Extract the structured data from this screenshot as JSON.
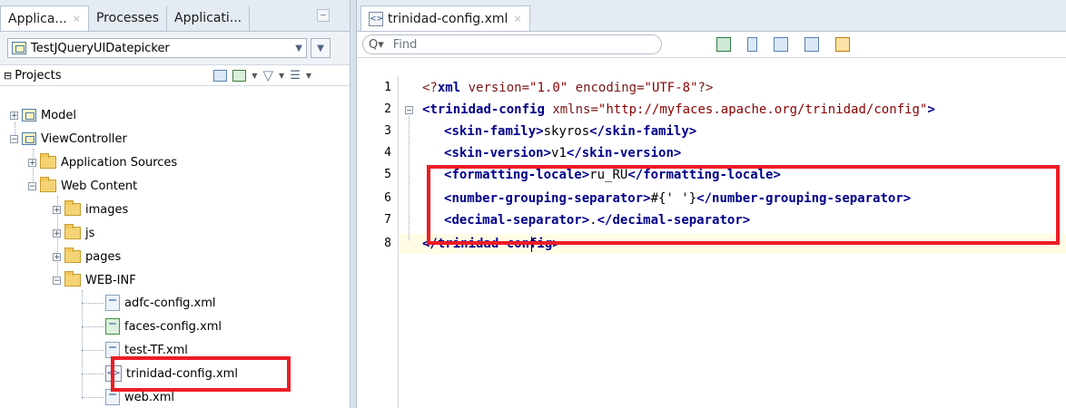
{
  "left_panel": {
    "tabs": [
      {
        "label": "Applica...",
        "close": "×"
      },
      {
        "label": "Processes"
      },
      {
        "label": "Applicati..."
      }
    ],
    "project_selector": "TestJQueryUIDatepicker",
    "projects_header": "Projects",
    "tree": [
      {
        "label": "Model",
        "expander": "+"
      },
      {
        "label": "ViewController",
        "expander": "−"
      },
      {
        "label": "Application Sources",
        "expander": "+"
      },
      {
        "label": "Web Content",
        "expander": "−"
      },
      {
        "label": "images",
        "expander": "+"
      },
      {
        "label": "js",
        "expander": "+"
      },
      {
        "label": "pages",
        "expander": "+"
      },
      {
        "label": "WEB-INF",
        "expander": "−"
      },
      {
        "label": "adfc-config.xml"
      },
      {
        "label": "faces-config.xml"
      },
      {
        "label": "test-TF.xml"
      },
      {
        "label": "trinidad-config.xml"
      },
      {
        "label": "web.xml"
      }
    ]
  },
  "editor": {
    "tab_label": "trinidad-config.xml",
    "tab_close": "×",
    "find_placeholder": "Find",
    "line_numbers": [
      "1",
      "2",
      "3",
      "4",
      "5",
      "6",
      "7",
      "8"
    ],
    "lines": [
      [
        "<?",
        "xml",
        " ",
        "version",
        "=",
        "\"1.0\"",
        " ",
        "encoding",
        "=",
        "\"UTF-8\"",
        "?>"
      ],
      [
        "<",
        "trinidad-config",
        " ",
        "xmlns",
        "=",
        "\"http://myfaces.apache.org/trinidad/config\"",
        ">"
      ],
      [
        "<",
        "skin-family",
        ">",
        "skyros",
        "</",
        "skin-family",
        ">"
      ],
      [
        "<",
        "skin-version",
        ">",
        "v1",
        "</",
        "skin-version",
        ">"
      ],
      [
        "<",
        "formatting-locale",
        ">",
        "ru_RU",
        "</",
        "formatting-locale",
        ">"
      ],
      [
        "<",
        "number-grouping-separator",
        ">",
        "#{' '}",
        "</",
        "number-grouping-separator",
        ">"
      ],
      [
        "<",
        "decimal-separator",
        ">",
        ".",
        "</",
        "decimal-separator",
        ">"
      ],
      [
        "</",
        "trinidad-config",
        ">"
      ]
    ]
  },
  "colors": {
    "highlight_box": "#ee1c25",
    "xml_tag": "#00008b",
    "xml_value": "#8b0000",
    "current_line": "#fffbe5"
  }
}
